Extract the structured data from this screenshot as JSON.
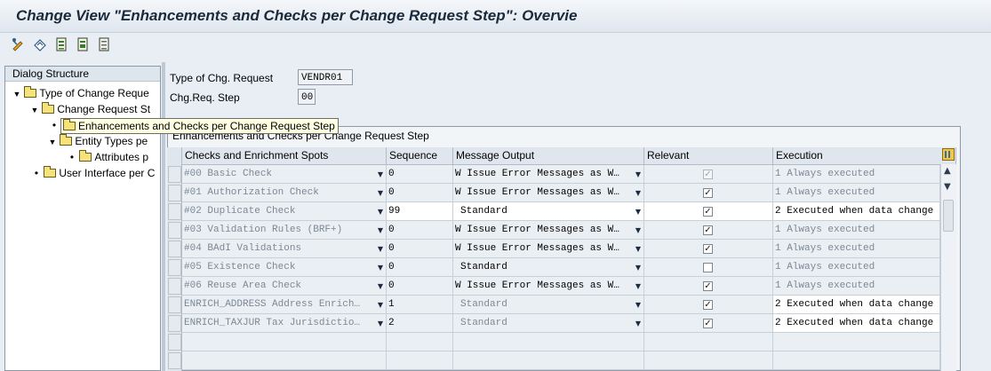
{
  "window": {
    "title": "Change View \"Enhancements and Checks per Change Request Step\": Overvie"
  },
  "toolbar": {
    "icons": [
      "display-change-icon",
      "other-entry-icon",
      "select-all-icon",
      "select-block-icon",
      "deselect-all-icon"
    ]
  },
  "dialog_structure": {
    "header": "Dialog Structure",
    "items": [
      {
        "label": "Type of Change Reque",
        "expanded": true
      },
      {
        "label": "Change Request St",
        "expanded": true
      },
      {
        "label": "Enhancements and Checks per Change Request Step",
        "selected": true
      },
      {
        "label": "Entity Types pe",
        "expanded": true
      },
      {
        "label": "Attributes p"
      },
      {
        "label": "User Interface per C"
      }
    ]
  },
  "tooltip": "Enhancements and Checks per Change Request Step",
  "fields": {
    "type_label": "Type of Chg. Request",
    "type_value": "VENDR01",
    "step_label": "Chg.Req. Step",
    "step_value": "00"
  },
  "table": {
    "title": "Enhancements and Checks per Change Request Step",
    "columns": [
      "Checks and Enrichment Spots",
      "Sequence",
      "Message Output",
      "Relevant",
      "Execution"
    ],
    "rows": [
      {
        "check": "#00 Basic Check",
        "seq": "0",
        "msg": "W Issue Error Messages as W…",
        "relevant": true,
        "relevant_disabled": true,
        "exec": "1 Always executed",
        "editable": false
      },
      {
        "check": "#01 Authorization Check",
        "seq": "0",
        "msg": "W Issue Error Messages as W…",
        "relevant": true,
        "relevant_disabled": false,
        "exec": "1 Always executed",
        "editable": false
      },
      {
        "check": "#02 Duplicate Check",
        "seq": "99",
        "msg": "Standard",
        "relevant": true,
        "relevant_disabled": false,
        "exec": "2 Executed when data change",
        "editable": true
      },
      {
        "check": "#03 Validation Rules (BRF+)",
        "seq": "0",
        "msg": "W Issue Error Messages as W…",
        "relevant": true,
        "relevant_disabled": false,
        "exec": "1 Always executed",
        "editable": false
      },
      {
        "check": "#04 BAdI Validations",
        "seq": "0",
        "msg": "W Issue Error Messages as W…",
        "relevant": true,
        "relevant_disabled": false,
        "exec": "1 Always executed",
        "editable": false
      },
      {
        "check": "#05 Existence Check",
        "seq": "0",
        "msg": "Standard",
        "relevant": false,
        "relevant_disabled": false,
        "exec": "1 Always executed",
        "editable": false
      },
      {
        "check": "#06 Reuse Area Check",
        "seq": "0",
        "msg": "W Issue Error Messages as W…",
        "relevant": true,
        "relevant_disabled": false,
        "exec": "1 Always executed",
        "editable": false
      },
      {
        "check": "ENRICH_ADDRESS Address Enrich…",
        "seq": "1",
        "msg": "Standard",
        "relevant": true,
        "relevant_disabled": false,
        "exec": "2 Executed when data change",
        "editable": false
      },
      {
        "check": "ENRICH_TAXJUR Tax Jurisdictio…",
        "seq": "2",
        "msg": "Standard",
        "relevant": true,
        "relevant_disabled": false,
        "exec": "2 Executed when data change",
        "editable": false
      }
    ]
  },
  "colors": {
    "background": "#e9eef4",
    "readonly_cell": "#eaeff4",
    "tooltip": "#ffffe1"
  }
}
